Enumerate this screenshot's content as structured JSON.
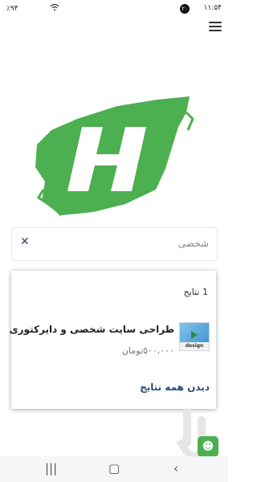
{
  "status_bar": {
    "time": "۱۱:۵۴",
    "notification_count": "۲۰",
    "battery": "٪۹۴"
  },
  "search": {
    "placeholder": "شخصی"
  },
  "results": {
    "count_label": "1 نتایج",
    "items": [
      {
        "title": "طراحی سایت شخصی و دایرکتوری",
        "price": "۵۰۰،۰۰۰تومان",
        "thumbnail_caption": "design"
      }
    ],
    "see_all_label": "دیدن همه نتایج"
  },
  "colors": {
    "brand_green": "#4caf50",
    "link_blue": "#2b4a7e"
  },
  "icons": {
    "menu": "hamburger-icon",
    "clear": "close-icon",
    "back": "back-icon",
    "home": "home-icon",
    "recents": "recents-icon"
  }
}
